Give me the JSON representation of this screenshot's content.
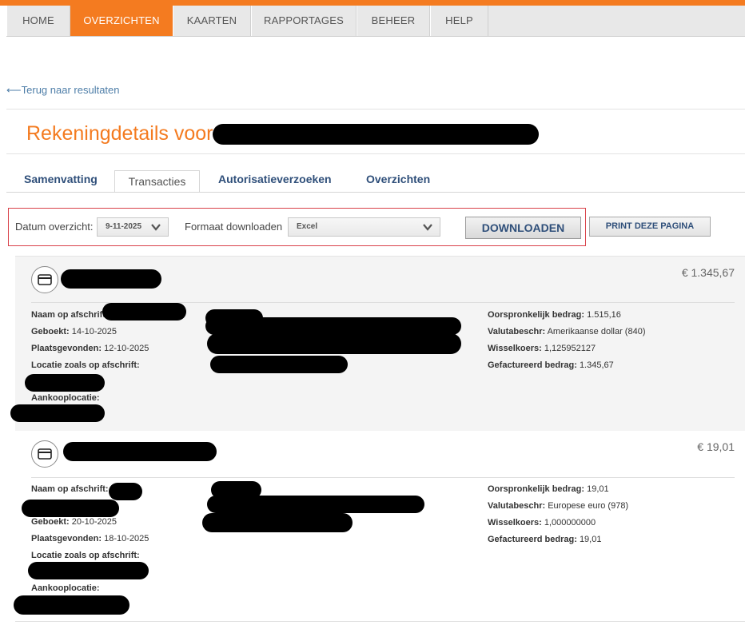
{
  "nav": {
    "items": [
      "HOME",
      "OVERZICHTEN",
      "KAARTEN",
      "RAPPORTAGES",
      "BEHEER",
      "HELP"
    ],
    "active": "OVERZICHTEN"
  },
  "back_link": "⟵Terug naar resultaten",
  "page_title": "Rekeningdetails voor",
  "tabs": [
    "Samenvatting",
    "Transacties",
    "Autorisatieverzoeken",
    "Overzichten"
  ],
  "active_tab": "Transacties",
  "filters": {
    "date_label": "Datum overzicht:",
    "date_value": "9-11-2025",
    "format_label": "Formaat downloaden",
    "format_value": "Excel",
    "download_label": "DOWNLOADEN",
    "print_label": "PRINT DEZE PAGINA"
  },
  "transactions": [
    {
      "amount": "€ 1.345,67",
      "name_label": "Naam op afschrift:",
      "booked_label": "Geboekt:",
      "booked": "14-10-2025",
      "occurred_label": "Plaatsgevonden:",
      "occurred": "12-10-2025",
      "location_label": "Locatie zoals op afschrift:",
      "purchase_label": "Aankooplocatie:",
      "orig_label": "Oorspronkelijk bedrag:",
      "orig": "1.515,16",
      "currency_label": "Valutabeschr:",
      "currency": "Amerikaanse dollar (840)",
      "rate_label": "Wisselkoers:",
      "rate": "1,125952127",
      "billed_label": "Gefactureerd bedrag:",
      "billed": "1.345,67"
    },
    {
      "amount": "€ 19,01",
      "name_label": "Naam op afschrift:",
      "booked_label": "Geboekt:",
      "booked": "20-10-2025",
      "occurred_label": "Plaatsgevonden:",
      "occurred": "18-10-2025",
      "location_label": "Locatie zoals op afschrift:",
      "purchase_label": "Aankooplocatie:",
      "orig_label": "Oorspronkelijk bedrag:",
      "orig": "19,01",
      "currency_label": "Valutabeschr:",
      "currency": "Europese euro (978)",
      "rate_label": "Wisselkoers:",
      "rate": "1,000000000",
      "billed_label": "Gefactureerd bedrag:",
      "billed": "19,01"
    }
  ],
  "icons": {
    "card": "credit-card-icon",
    "dropdown": "chevron-down-icon"
  },
  "colors": {
    "accent": "#f47b20",
    "link": "#4e7ea8",
    "tab_text": "#2f4f7a",
    "filter_border": "#d9424a"
  }
}
